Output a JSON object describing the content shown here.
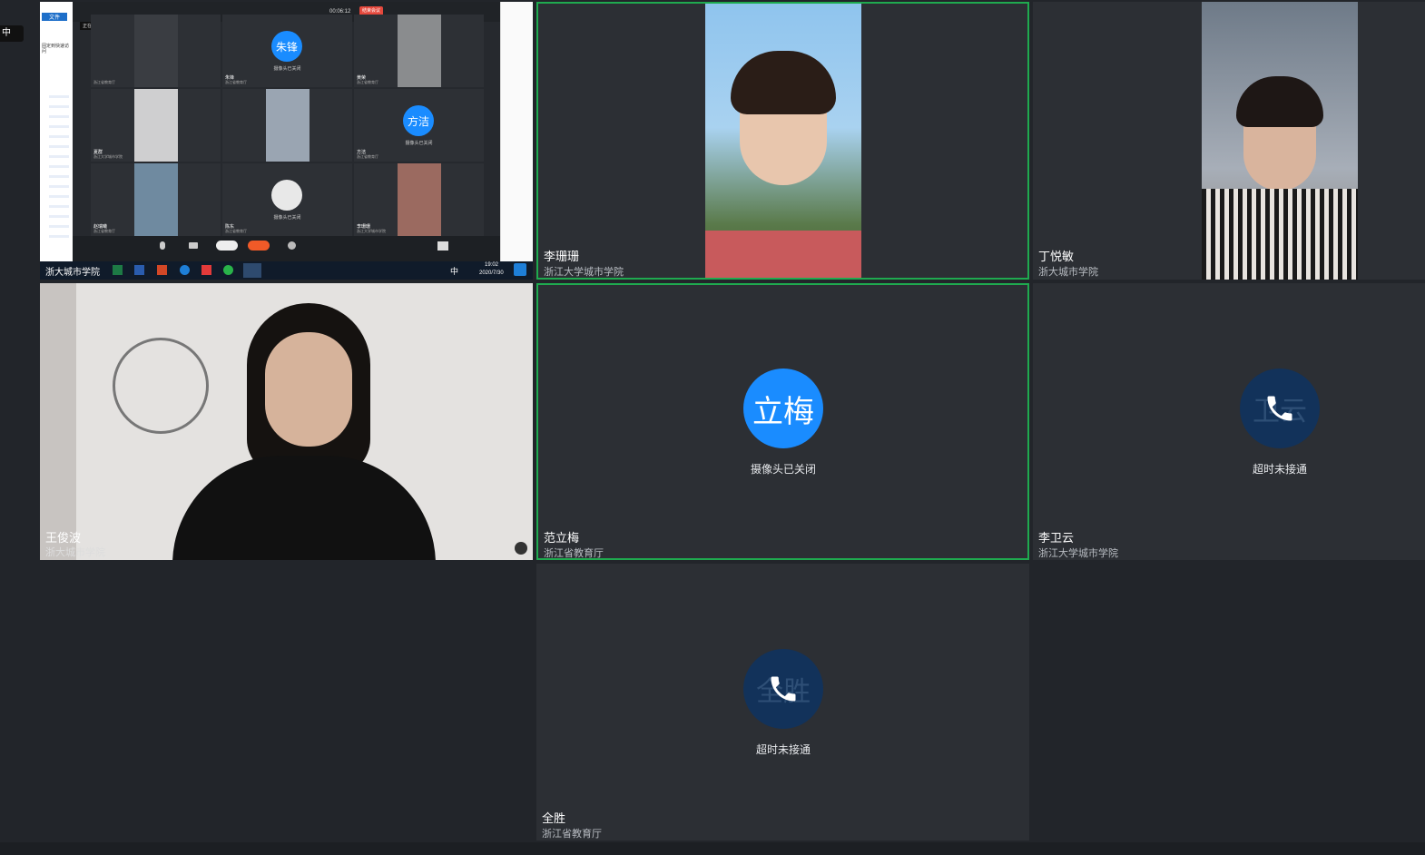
{
  "participants": [
    {
      "name": "李珊珊",
      "org": "浙江大学城市学院",
      "active": true
    },
    {
      "name": "丁悦敏",
      "org": "浙大城市学院",
      "active": false
    },
    {
      "name": "王俊波",
      "org": "浙大城市学院",
      "active": false
    },
    {
      "name": "范立梅",
      "org": "浙江省教育厅",
      "active": true,
      "avatar_text": "立梅",
      "status": "摄像头已关闭"
    },
    {
      "name": "李卫云",
      "org": "浙江大学城市学院",
      "active": false,
      "avatar_text": "卫云",
      "status": "超时未接通"
    },
    {
      "name": "全胜",
      "org": "浙江省教育厅",
      "active": false,
      "avatar_text": "全胜",
      "status": "超时未接通"
    }
  ],
  "shared_screen": {
    "timer": "00:06:12",
    "end_button": "结束会议",
    "sharing_label": "正在共享中",
    "side_tab_label": "中",
    "explorer_tab": "文件",
    "explorer_actions": "固定到快速访问",
    "tiles": [
      {
        "name": "",
        "org": "浙江省教育厅"
      },
      {
        "name": "朱锋",
        "avatar": "朱锋",
        "status": "摄像头已关闭",
        "org": "浙江省教育厅"
      },
      {
        "name": "黄荣",
        "org": "浙江省教育厅"
      },
      {
        "name": "夏群",
        "org": "浙江大学城市学院"
      },
      {
        "name": "",
        "org": ""
      },
      {
        "name": "方洁",
        "avatar": "方洁",
        "status": "摄像头已关闭",
        "org": "浙江省教育厅"
      },
      {
        "name": "赵瑞曦",
        "org": "浙江省教育厅"
      },
      {
        "name": "陈东",
        "status": "摄像头已关闭",
        "org": "浙江省教育厅"
      },
      {
        "name": "李珊珊",
        "org": "浙江大学城市学院"
      }
    ],
    "taskbar_app_label": "浙大城市学院",
    "clock_time": "19:02",
    "clock_date": "2020/7/30",
    "ime_label": "中"
  },
  "colors": {
    "active_border": "#1faa4f",
    "avatar_blue": "#1a8cff",
    "avatar_dark": "#12325a",
    "background": "#22252a",
    "tile": "#2c2f34"
  }
}
